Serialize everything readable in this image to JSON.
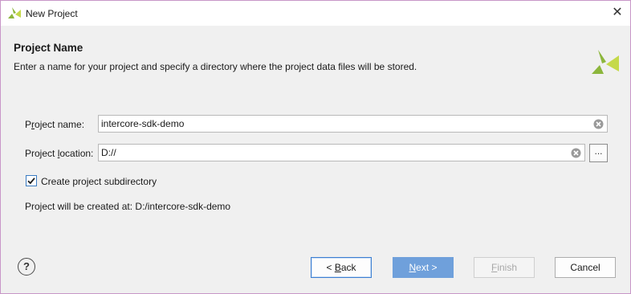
{
  "window": {
    "title": "New Project",
    "close_label": "✕"
  },
  "header": {
    "title": "Project Name",
    "subtitle": "Enter a name for your project and specify a directory where the project data files will be stored."
  },
  "form": {
    "project_name_label_pre": "P",
    "project_name_label_u": "r",
    "project_name_label_post": "oject name:",
    "project_name_value": "intercore-sdk-demo",
    "project_location_label_pre": "Project ",
    "project_location_label_u": "l",
    "project_location_label_post": "ocation:",
    "project_location_value": "D://",
    "browse_label": "...",
    "subdir_checked": true,
    "subdir_label": "Create project subdirectory",
    "created_at_text": "Project will be created at: D:/intercore-sdk-demo"
  },
  "footer": {
    "help_label": "?",
    "back_pre": "< ",
    "back_u": "B",
    "back_post": "ack",
    "next_u": "N",
    "next_post": "ext >",
    "finish_u": "F",
    "finish_post": "inish",
    "cancel_label": "Cancel"
  }
}
